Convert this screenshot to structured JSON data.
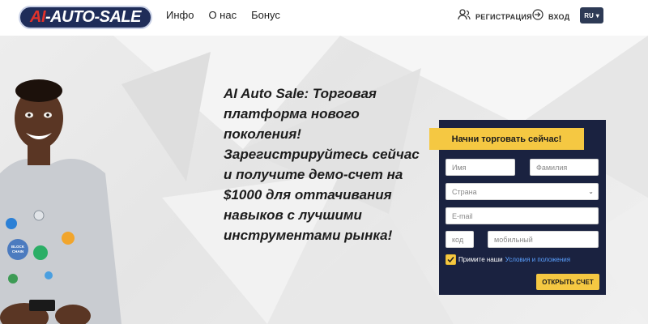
{
  "header": {
    "logo_prefix": "AI",
    "logo_suffix": "-AUTO-SALE",
    "nav": [
      "Инфо",
      "О нас",
      "Бонус"
    ],
    "register_label": "РЕГИСТРАЦИЯ",
    "login_label": "ВХОД",
    "language": "RU"
  },
  "hero": {
    "headline": "AI Auto Sale: Торговая платформа нового поколения! Зарегистрируйтесь сейчас и получите демо-счет на $1000 для оттачивания навыков с лучшими инструментами рынка!",
    "chip_labels": [
      "BLOCK CHAIN"
    ]
  },
  "form": {
    "title": "Начни торговать сейчас!",
    "first_name_placeholder": "Имя",
    "last_name_placeholder": "Фамилия",
    "country_placeholder": "Страна",
    "email_placeholder": "E-mail",
    "code_placeholder": "код",
    "phone_placeholder": "мобильный",
    "terms_prefix": "Примите наши",
    "terms_link": "Условия и положения",
    "submit_label": "ОТКРЫТЬ СЧЕТ"
  },
  "colors": {
    "panel": "#1a2240",
    "accent": "#f5c842",
    "lang_bg": "#2d3a55",
    "logo_bg": "#1f2d59",
    "logo_red": "#e0322b"
  }
}
